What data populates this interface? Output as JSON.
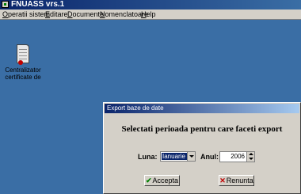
{
  "app": {
    "title": "FNUASS vrs.1",
    "colors": {
      "titlebar": "#0a246a",
      "desktop": "#3a6ea5",
      "face": "#d4d0c8"
    }
  },
  "menu": {
    "items": [
      {
        "label": "Operatii sistem"
      },
      {
        "label": "Editare"
      },
      {
        "label": "Documente"
      },
      {
        "label": "Nomenclatoare"
      },
      {
        "label": "Help"
      }
    ]
  },
  "desktop": {
    "icon": {
      "name": "document-icon",
      "label_line1": "Centralizator",
      "label_line2": "certificate de"
    }
  },
  "dialog": {
    "title": "Export baze de date",
    "heading": "Selectati perioada pentru care faceti export",
    "luna_label": "Luna:",
    "luna_value": "Ianuarie",
    "anul_label": "Anul:",
    "anul_value": "2006",
    "accept_label": "Accepta",
    "cancel_label": "Renunta"
  }
}
